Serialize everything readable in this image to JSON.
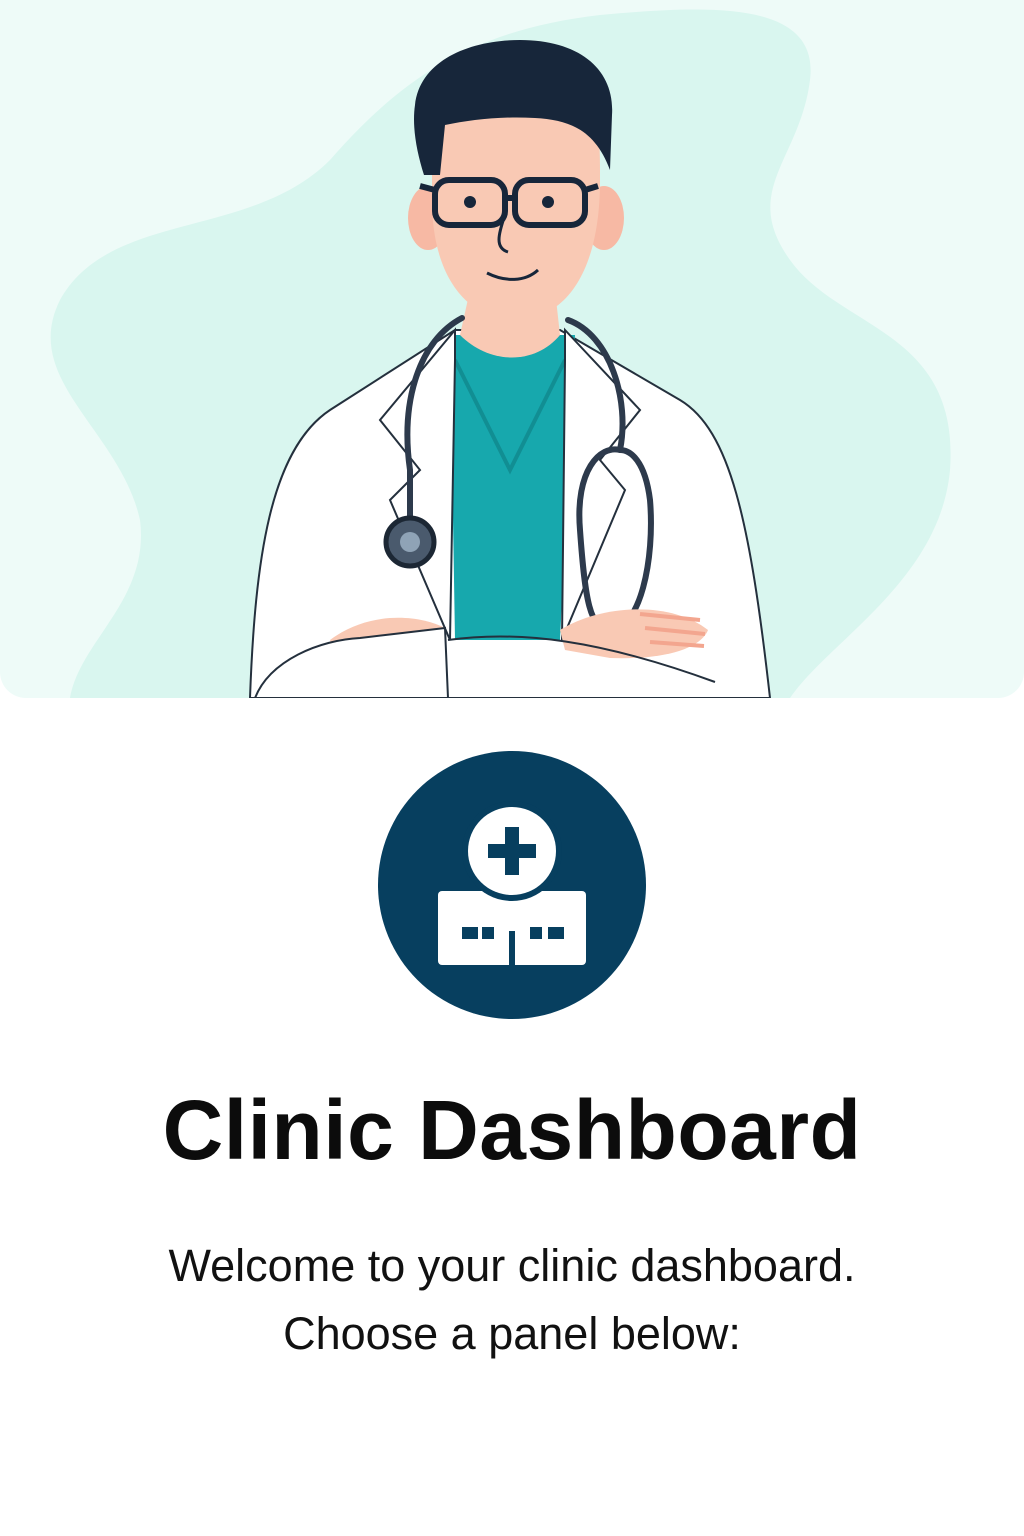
{
  "header": {
    "illustration": "doctor-with-stethoscope-illustration",
    "colors": {
      "background_blob": "#d9f6ef",
      "scrubs": "#17a8ad",
      "hair": "#17263a",
      "skin": "#f9c9b4",
      "coat": "#ffffff"
    }
  },
  "logo": {
    "icon": "clinic-building-cross-icon",
    "color": "#073f5f"
  },
  "title": "Clinic Dashboard",
  "welcome": {
    "line1": "Welcome to your clinic dashboard.",
    "line2": "Choose a panel below:"
  }
}
